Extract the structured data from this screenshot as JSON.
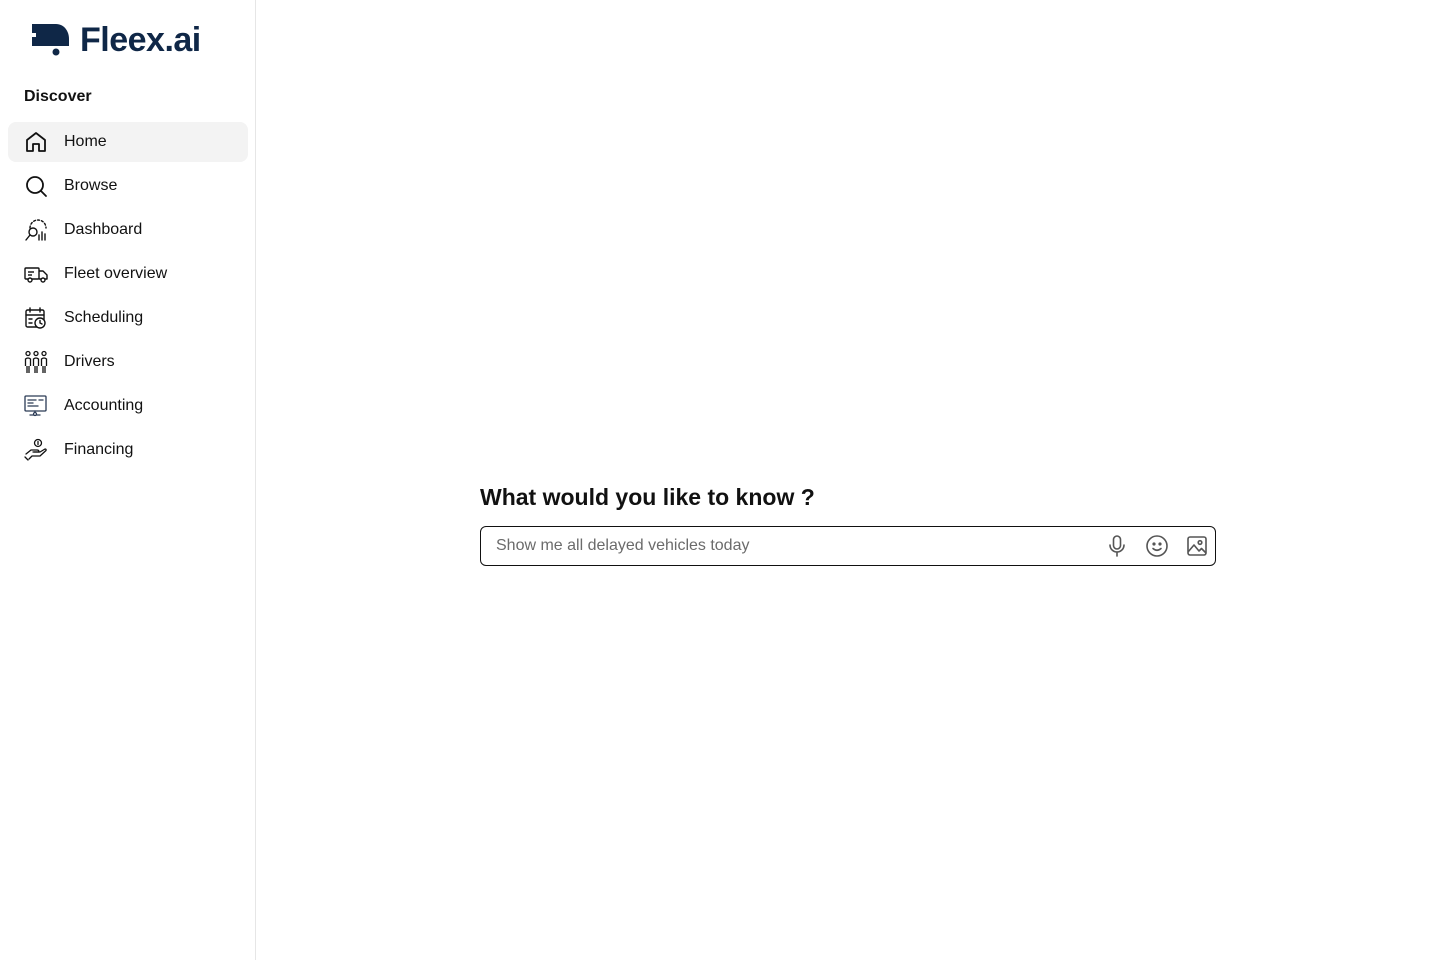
{
  "brand": {
    "name": "Fleex.ai",
    "color": "#0f2747"
  },
  "sidebar": {
    "section_title": "Discover",
    "items": [
      {
        "label": "Home",
        "icon": "home-icon",
        "active": true
      },
      {
        "label": "Browse",
        "icon": "search-icon",
        "active": false
      },
      {
        "label": "Dashboard",
        "icon": "dashboard-icon",
        "active": false
      },
      {
        "label": "Fleet overview",
        "icon": "truck-icon",
        "active": false
      },
      {
        "label": "Scheduling",
        "icon": "calendar-clock-icon",
        "active": false
      },
      {
        "label": "Drivers",
        "icon": "people-icon",
        "active": false
      },
      {
        "label": "Accounting",
        "icon": "monitor-icon",
        "active": false
      },
      {
        "label": "Financing",
        "icon": "hand-coin-icon",
        "active": false
      }
    ]
  },
  "main": {
    "question": "What would you like to know ?",
    "search": {
      "placeholder": "Show me all delayed vehicles today",
      "value": ""
    },
    "actions": [
      {
        "icon": "microphone-icon"
      },
      {
        "icon": "emoji-icon"
      },
      {
        "icon": "image-icon"
      }
    ]
  }
}
